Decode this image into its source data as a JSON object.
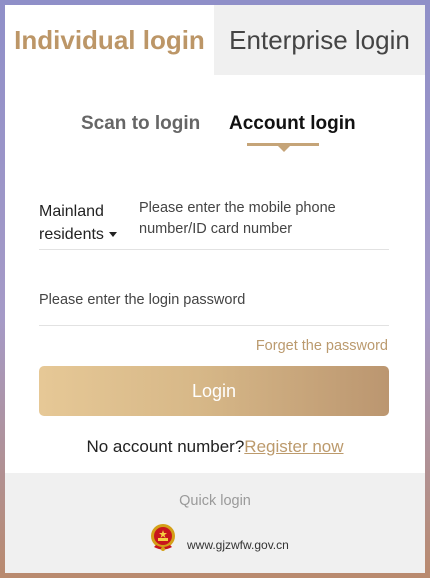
{
  "tabs": {
    "individual": "Individual login",
    "enterprise": "Enterprise login"
  },
  "sub_tabs": {
    "scan": "Scan to login",
    "account": "Account login"
  },
  "form": {
    "resident_line1": "Mainland",
    "resident_line2": "residents",
    "phone_placeholder": "Please enter the mobile phone number/ID card number",
    "password_placeholder": "Please enter the login password",
    "forget": "Forget the password",
    "login_button": "Login",
    "no_account": "No account number?",
    "register": "Register now"
  },
  "footer": {
    "quick_login": "Quick login",
    "url": "www.gjzwfw.gov.cn",
    "emblem_icon": "national-emblem-icon"
  },
  "colors": {
    "accent": "#bc9667",
    "button_start": "#e6c896",
    "button_end": "#bb9670"
  }
}
